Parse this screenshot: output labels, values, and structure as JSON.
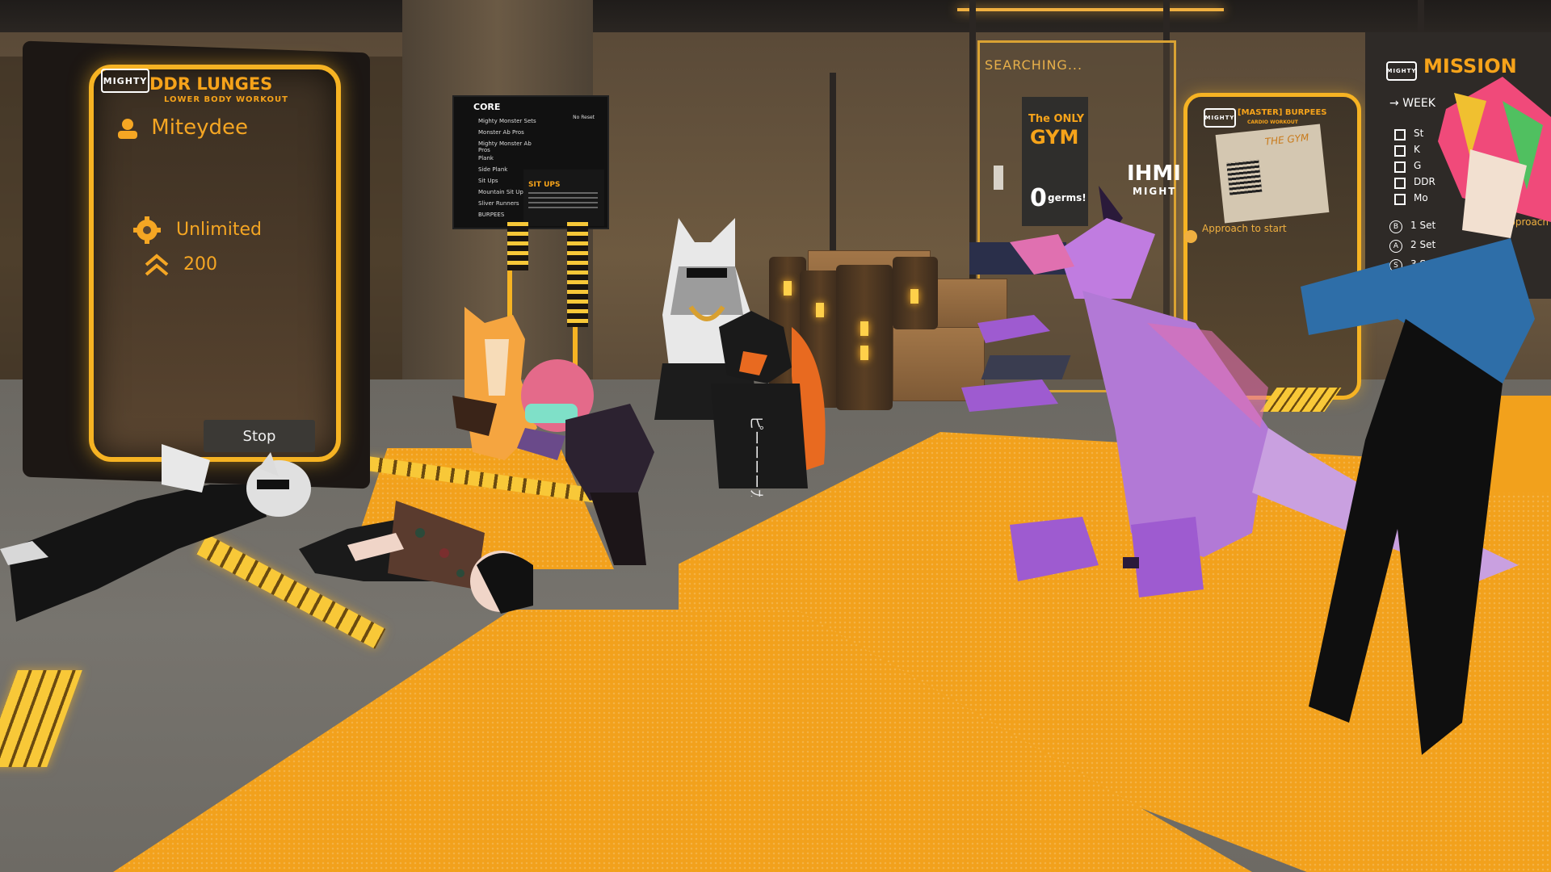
{
  "ddr_panel": {
    "brand": "MIGHTY",
    "title": "DDR LUNGES",
    "subtitle": "LOWER BODY WORKOUT",
    "player_name": "Miteydee",
    "mode_label": "Unlimited",
    "level_value": "200",
    "stop_label": "Stop"
  },
  "core_board": {
    "title": "CORE",
    "tag": "No Reset",
    "items": [
      "Mighty Monster Sets",
      "Monster Ab Pros",
      "Mighty Monster Ab Pros",
      "Plank",
      "Side Plank",
      "Sit Ups",
      "Mountain Sit Ups",
      "Sliver Runners",
      "BURPEES"
    ],
    "detail_title": "SIT UPS"
  },
  "searching_panel": {
    "status": "SEARCHING..."
  },
  "poster": {
    "line1": "The ONLY",
    "line2": "GYM",
    "count": "0",
    "count_suffix": "germs!"
  },
  "wall_brand": {
    "logo": "IHMI",
    "name": "MIGHT"
  },
  "burpees_panel": {
    "brand": "MIGHTY",
    "title": "[MASTER] BURPEES",
    "subtitle": "CARDIO WORKOUT",
    "card_title": "THE GYM",
    "approach": "Approach to start"
  },
  "mission_board": {
    "brand": "MIGHTY",
    "title": "MISSION",
    "week_label": "WEEK",
    "tasks": [
      "St",
      "K",
      "G",
      "DDR",
      "Mo"
    ],
    "sets": [
      {
        "button": "B",
        "label": "1 Set"
      },
      {
        "button": "A",
        "label": "2 Set"
      },
      {
        "button": "S",
        "label": "3 Set"
      }
    ],
    "approach": "Approach"
  },
  "shirt_text": "ピーーーーカイジ",
  "colors": {
    "accent": "#f6a31a",
    "neon": "#f6b323",
    "mat": "#f2a11c",
    "dragon": "#b279d6"
  }
}
